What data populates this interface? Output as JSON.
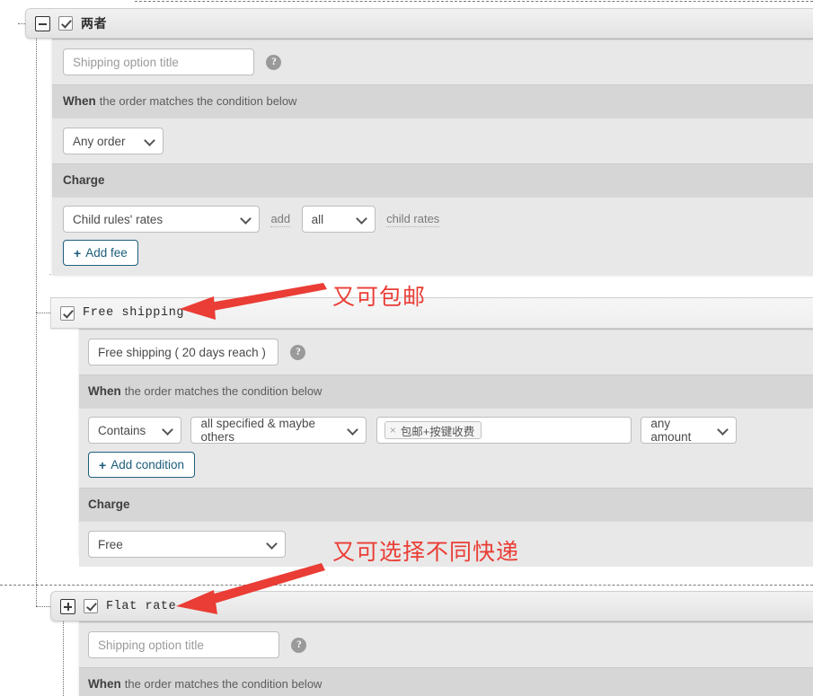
{
  "nodes": {
    "both": {
      "label": "两者",
      "toggle": "collapse",
      "checked": true,
      "title_placeholder": "Shipping option title",
      "title_value": "",
      "when_label": "When",
      "when_text": "the order matches the condition below",
      "condition_select": "Any order",
      "charge_label": "Charge",
      "charge_select": "Child rules' rates",
      "add_label": "add",
      "add_amount_select": "all",
      "child_rates_label": "child rates",
      "add_fee_button": "Add fee",
      "help_icon": "help-icon"
    },
    "free_shipping": {
      "label": "Free shipping",
      "checked": true,
      "title_placeholder": "Free shipping ( 20 days reach )",
      "title_value": "Free shipping ( 20 days reach )",
      "when_label": "When",
      "when_text": "the order matches the condition below",
      "match_select": "Contains",
      "scope_select": "all specified & maybe others",
      "tag_remove": "×",
      "tag_label": "包邮+按键收费",
      "amount_select": "any amount",
      "add_condition_button": "Add condition",
      "charge_label": "Charge",
      "charge_select": "Free"
    },
    "flat_rate": {
      "label": "Flat rate",
      "toggle": "expand",
      "checked": true,
      "title_placeholder": "Shipping option title",
      "title_value": "",
      "when_label": "When",
      "when_text": "the order matches the condition below"
    }
  },
  "annotations": [
    {
      "text": "又可包邮",
      "color": "#ea3d35"
    },
    {
      "text": "又可选择不同快递",
      "color": "#ea3d35"
    }
  ]
}
